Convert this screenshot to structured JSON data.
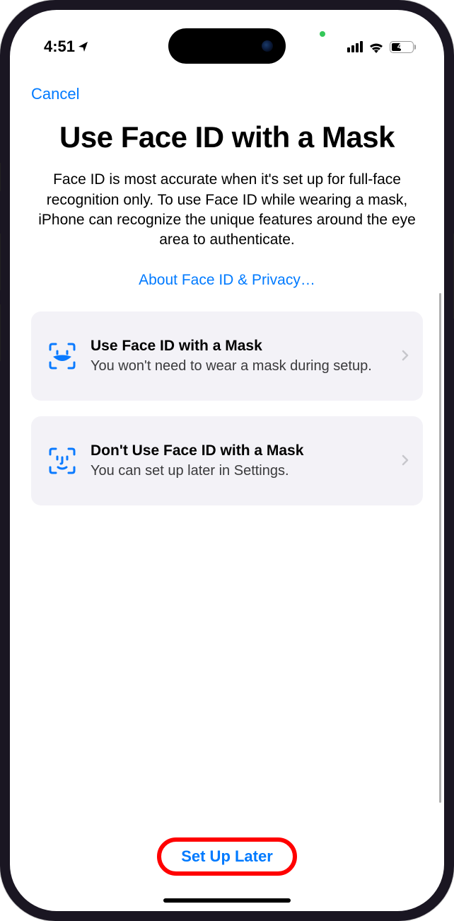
{
  "status": {
    "time": "4:51",
    "battery": "40"
  },
  "nav": {
    "cancel": "Cancel"
  },
  "page": {
    "title": "Use Face ID with a Mask",
    "description": "Face ID is most accurate when it's set up for full-face recognition only. To use Face ID while wearing a mask, iPhone can recognize the unique features around the eye area to authenticate.",
    "privacy_link": "About Face ID & Privacy…"
  },
  "options": [
    {
      "title": "Use Face ID with a Mask",
      "subtitle": "You won't need to wear a mask during setup."
    },
    {
      "title": "Don't Use Face ID with a Mask",
      "subtitle": "You can set up later in Settings."
    }
  ],
  "footer": {
    "setup_later": "Set Up Later"
  }
}
